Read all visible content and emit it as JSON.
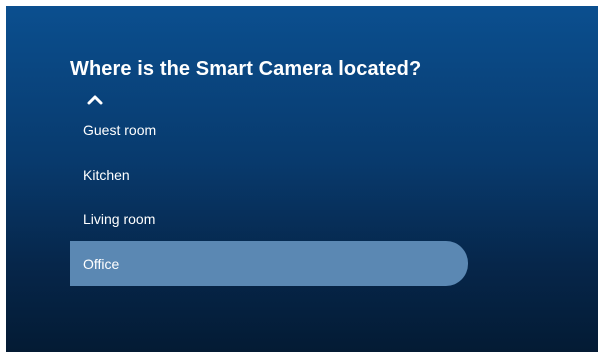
{
  "dialog": {
    "title": "Where is the Smart Camera located?",
    "scroll_up_icon": "chevron-up-icon"
  },
  "options": [
    {
      "label": "Guest room",
      "selected": false
    },
    {
      "label": "Kitchen",
      "selected": false
    },
    {
      "label": "Living room",
      "selected": false
    },
    {
      "label": "Office",
      "selected": true
    }
  ],
  "colors": {
    "background_top": "#0b4f8f",
    "background_bottom": "#041b34",
    "selection": "#5b88b3",
    "text": "#ffffff"
  }
}
